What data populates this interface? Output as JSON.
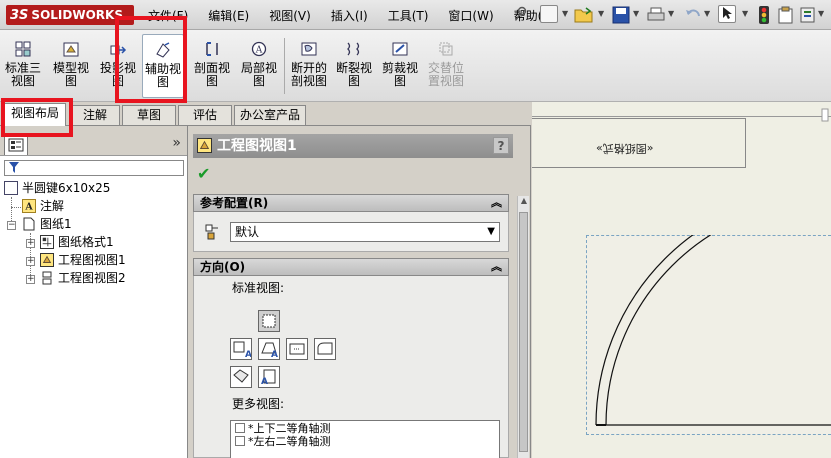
{
  "app": {
    "logo_text": "SOLIDWORKS",
    "logo_mark": "3S",
    "brand_color": "#b31b1b"
  },
  "menu": [
    "文件(F)",
    "编辑(E)",
    "视图(V)",
    "插入(I)",
    "工具(T)",
    "窗口(W)",
    "帮助(H)"
  ],
  "commands": [
    {
      "label": "标准三\n视图",
      "icon": "standard-3-view-icon"
    },
    {
      "label": "模型视\n图",
      "icon": "model-view-icon"
    },
    {
      "label": "投影视\n图",
      "icon": "projected-view-icon"
    },
    {
      "label": "辅助视\n图",
      "icon": "auxiliary-view-icon"
    },
    {
      "label": "剖面视\n图",
      "icon": "section-view-icon"
    },
    {
      "label": "局部视\n图",
      "icon": "detail-view-icon"
    },
    {
      "label": "断开的\n剖视图",
      "icon": "broken-out-section-icon"
    },
    {
      "label": "断裂视\n图",
      "icon": "break-view-icon"
    },
    {
      "label": "剪裁视\n图",
      "icon": "crop-view-icon"
    },
    {
      "label": "交替位\n置视图",
      "icon": "alternate-position-view-icon"
    }
  ],
  "tabs": [
    "视图布局",
    "注解",
    "草图",
    "评估",
    "办公室产品"
  ],
  "tree": {
    "root": "半圆键6x10x25",
    "items": [
      "注解",
      "图纸1",
      "图纸格式1",
      "工程图视图1",
      "工程图视图2"
    ]
  },
  "pm": {
    "title": "工程图视图1",
    "help": "?",
    "ok_icon": "✔",
    "ref_config": {
      "header": "参考配置(R)",
      "selected": "默认"
    },
    "orientation": {
      "header": "方向(O)",
      "standard_label": "标准视图:",
      "more_label": "更多视图:",
      "more_items": [
        "*上下二等角轴测",
        "*左右二等角轴测"
      ]
    }
  },
  "drawing": {
    "mirrored_note": "«图纸格式»"
  },
  "colors": {
    "highlight": "#e8141f",
    "ok_green": "#1a9b2a",
    "view_frame": "#7aa4c2"
  }
}
